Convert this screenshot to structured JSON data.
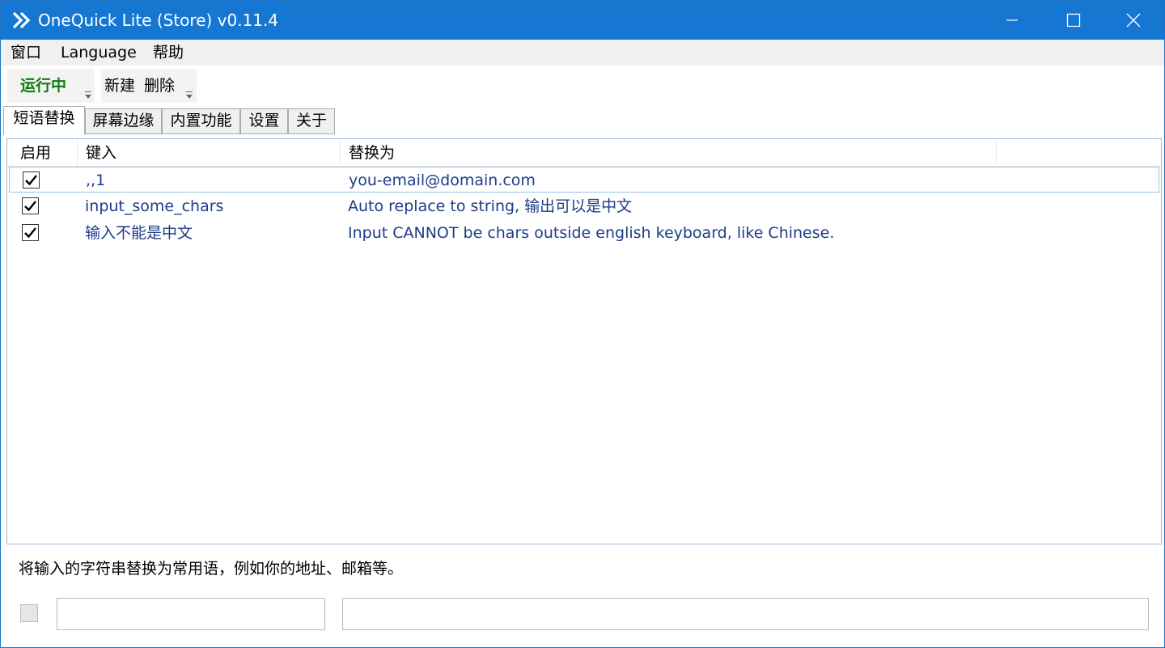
{
  "window": {
    "title": "OneQuick Lite (Store) v0.11.4",
    "accent_color": "#1677d2"
  },
  "menu": [
    {
      "label": "窗口"
    },
    {
      "label": "Language"
    },
    {
      "label": "帮助"
    }
  ],
  "toolbar": {
    "run_label": "运行中",
    "new_label": "新建",
    "delete_label": "删除"
  },
  "tabs": [
    {
      "label": "短语替换",
      "active": true
    },
    {
      "label": "屏幕边缘"
    },
    {
      "label": "内置功能"
    },
    {
      "label": "设置"
    },
    {
      "label": "关于"
    }
  ],
  "table": {
    "columns": [
      "启用",
      "键入",
      "替换为"
    ],
    "rows": [
      {
        "enabled": true,
        "key": ",,1",
        "value": "you-email@domain.com"
      },
      {
        "enabled": true,
        "key": "input_some_chars",
        "value": "Auto replace to string, 输出可以是中文"
      },
      {
        "enabled": true,
        "key": "输入不能是中文",
        "value": "Input CANNOT be chars outside english keyboard, like Chinese."
      }
    ]
  },
  "description": "将输入的字符串替换为常用语，例如你的地址、邮箱等。",
  "editor": {
    "key_value": "",
    "value_value": ""
  }
}
